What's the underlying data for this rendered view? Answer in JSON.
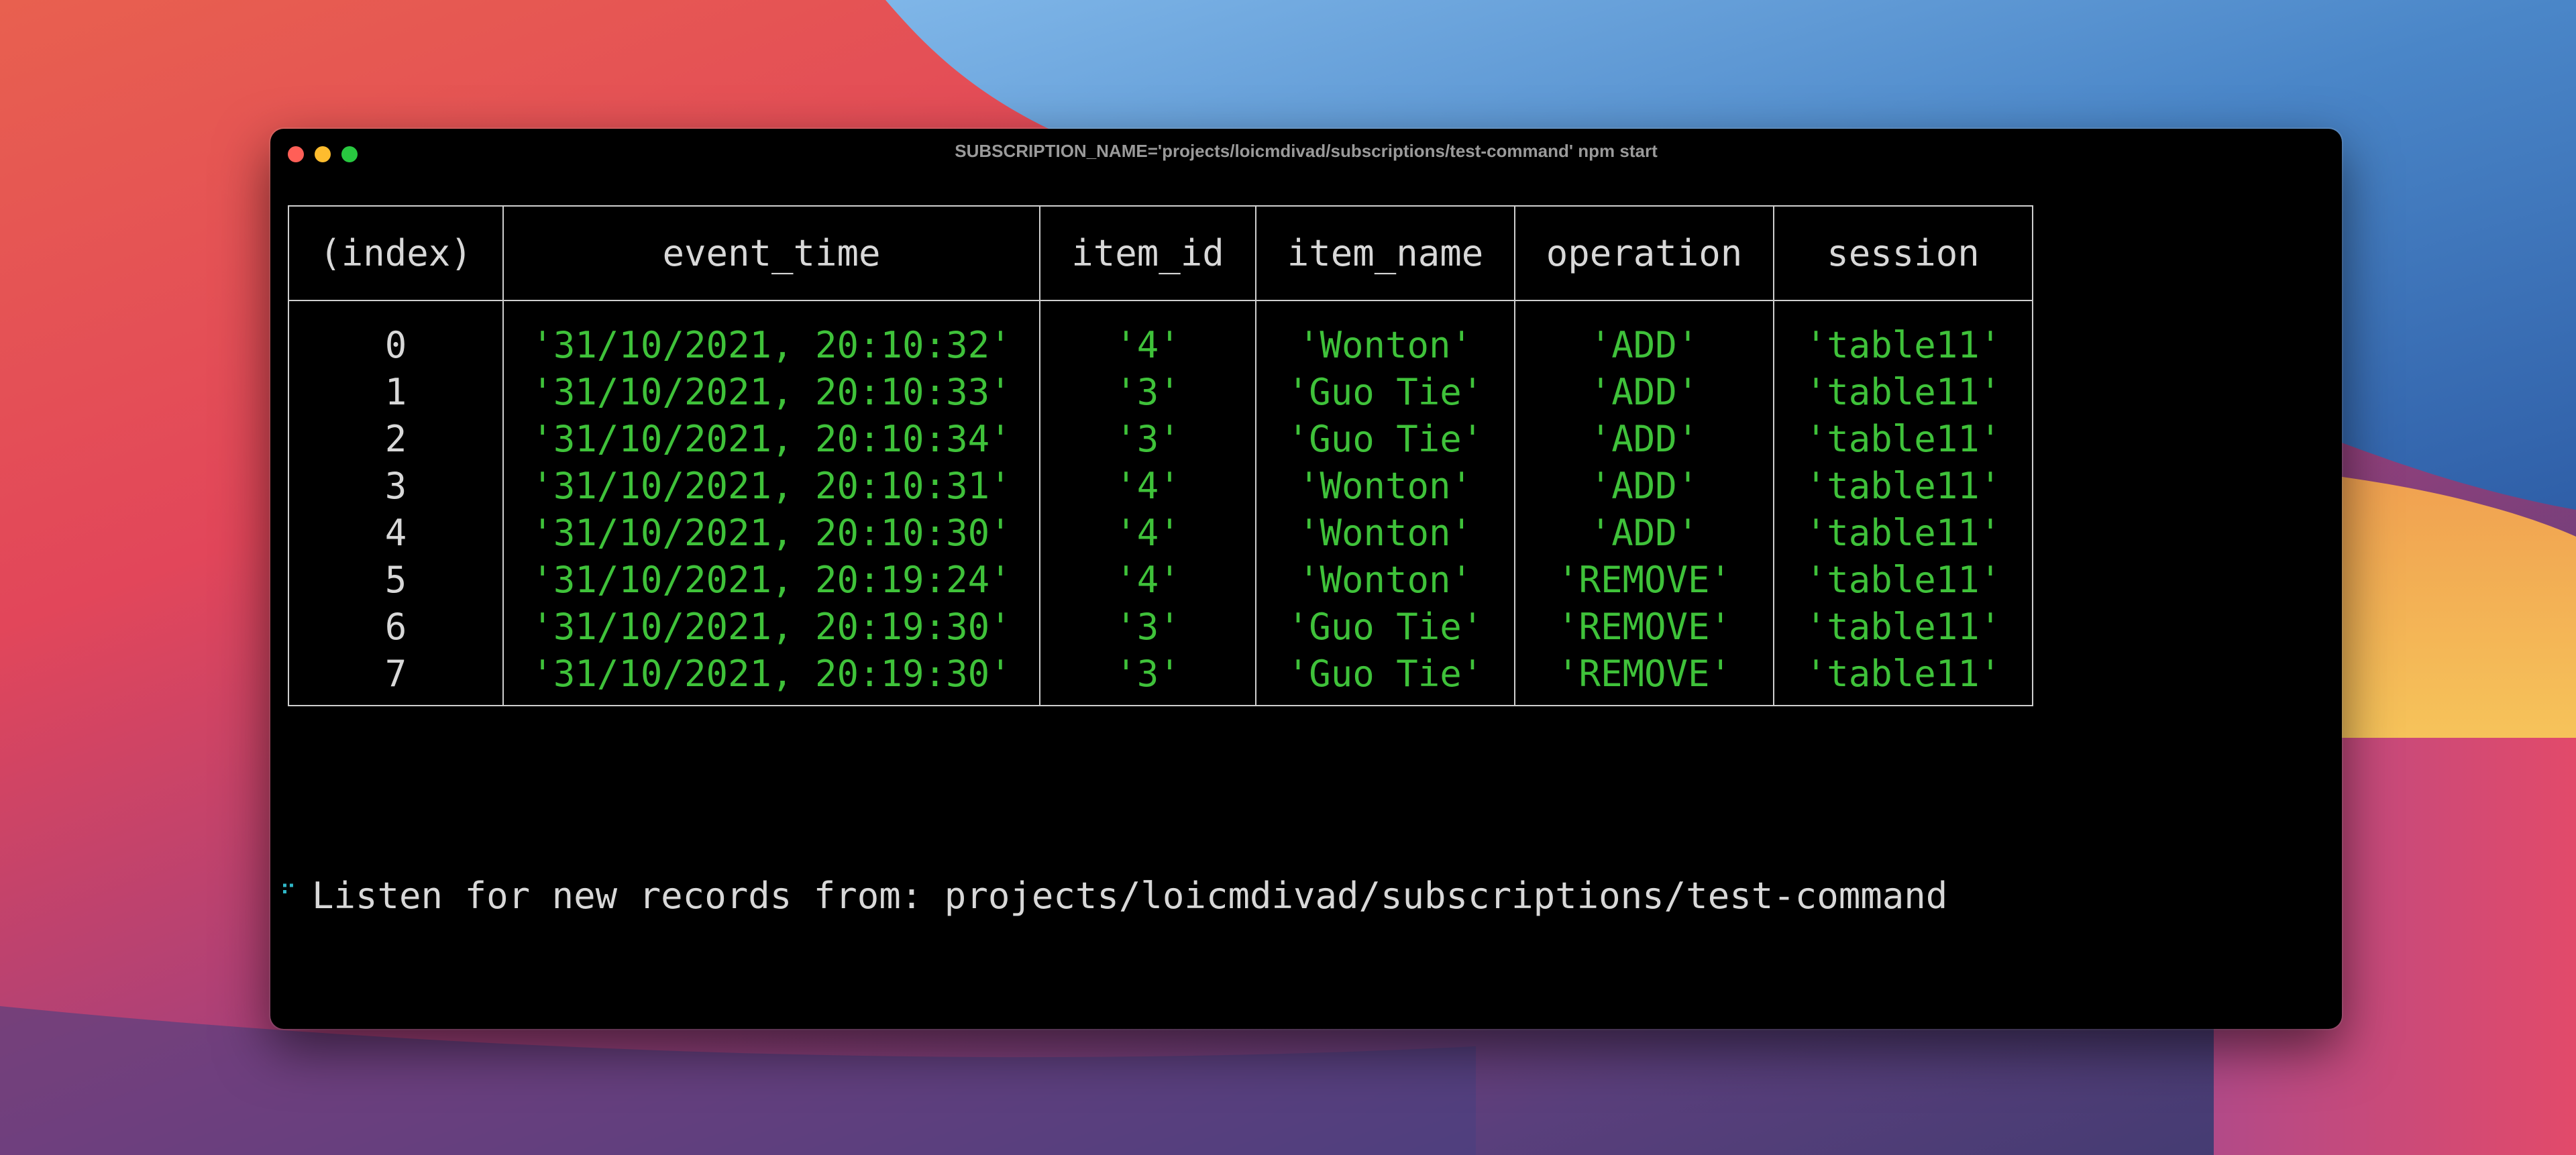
{
  "window": {
    "title": "SUBSCRIPTION_NAME='projects/loicmdivad/subscriptions/test-command' npm start"
  },
  "table": {
    "headers": [
      "(index)",
      "event_time",
      "item_id",
      "item_name",
      "operation",
      "session"
    ],
    "rows": [
      [
        "0",
        "'31/10/2021, 20:10:32'",
        "'4'",
        "'Wonton'",
        "'ADD'",
        "'table11'"
      ],
      [
        "1",
        "'31/10/2021, 20:10:33'",
        "'3'",
        "'Guo Tie'",
        "'ADD'",
        "'table11'"
      ],
      [
        "2",
        "'31/10/2021, 20:10:34'",
        "'3'",
        "'Guo Tie'",
        "'ADD'",
        "'table11'"
      ],
      [
        "3",
        "'31/10/2021, 20:10:31'",
        "'4'",
        "'Wonton'",
        "'ADD'",
        "'table11'"
      ],
      [
        "4",
        "'31/10/2021, 20:10:30'",
        "'4'",
        "'Wonton'",
        "'ADD'",
        "'table11'"
      ],
      [
        "5",
        "'31/10/2021, 20:19:24'",
        "'4'",
        "'Wonton'",
        "'REMOVE'",
        "'table11'"
      ],
      [
        "6",
        "'31/10/2021, 20:19:30'",
        "'3'",
        "'Guo Tie'",
        "'REMOVE'",
        "'table11'"
      ],
      [
        "7",
        "'31/10/2021, 20:19:30'",
        "'3'",
        "'Guo Tie'",
        "'REMOVE'",
        "'table11'"
      ]
    ]
  },
  "status": {
    "spinner_icon": "braille-spinner-icon",
    "spinner_glyph": "⠋",
    "text": "Listen for new records from: projects/loicmdivad/subscriptions/test-command"
  },
  "colors": {
    "terminal_bg": "#000000",
    "value_green": "#3fc23a",
    "text": "#d8d8d8",
    "spinner": "#2fb8c8"
  }
}
